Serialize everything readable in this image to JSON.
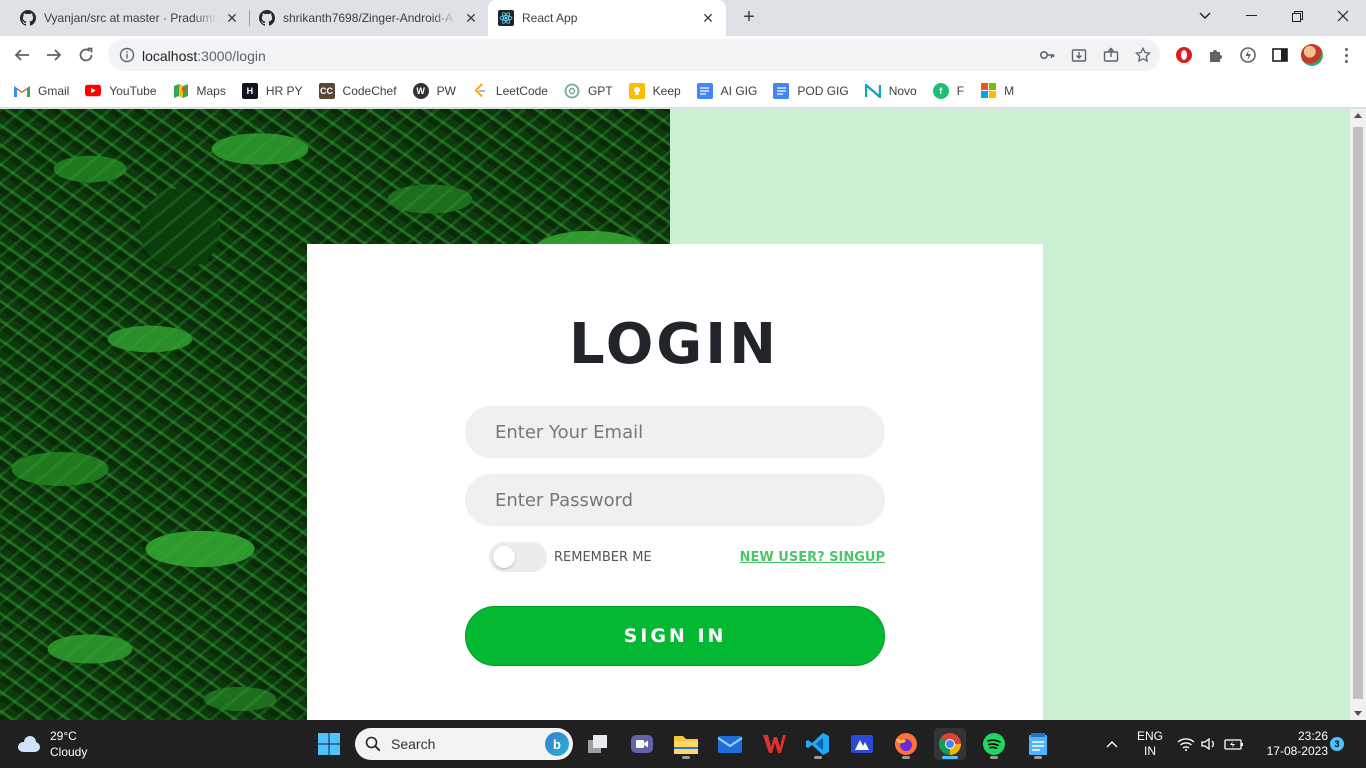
{
  "browser": {
    "tabs": [
      {
        "title": "Vyanjan/src at master · Pradumn",
        "favicon": "github-icon"
      },
      {
        "title": "shrikanth7698/Zinger-Android-A",
        "favicon": "github-icon"
      },
      {
        "title": "React App",
        "favicon": "react-icon"
      }
    ],
    "address": {
      "host": "localhost",
      "path": ":3000/login"
    },
    "bookmarks": [
      {
        "label": "Gmail",
        "icon": "gmail-icon",
        "color": "#ea4335"
      },
      {
        "label": "YouTube",
        "icon": "youtube-icon",
        "color": "#ff0000"
      },
      {
        "label": "Maps",
        "icon": "maps-icon",
        "color": "#34a853"
      },
      {
        "label": "HR PY",
        "icon": "hackerrank-icon",
        "color": "#0e141e"
      },
      {
        "label": "CodeChef",
        "icon": "codechef-icon",
        "color": "#5b4638"
      },
      {
        "label": "PW",
        "icon": "pw-icon",
        "color": "#333333"
      },
      {
        "label": "LeetCode",
        "icon": "leetcode-icon",
        "color": "#ffa116"
      },
      {
        "label": "GPT",
        "icon": "openai-icon",
        "color": "#74aa9c"
      },
      {
        "label": "Keep",
        "icon": "keep-icon",
        "color": "#fbbc04"
      },
      {
        "label": "AI GIG",
        "icon": "docs-icon",
        "color": "#4285f4"
      },
      {
        "label": "POD GIG",
        "icon": "docs-icon",
        "color": "#4285f4"
      },
      {
        "label": "Novo",
        "icon": "novo-icon",
        "color": "#13a3c2"
      },
      {
        "label": "F",
        "icon": "fiverr-icon",
        "color": "#1dbf73"
      },
      {
        "label": "M",
        "icon": "microsoft-icon",
        "color": "#f25022"
      }
    ]
  },
  "login": {
    "title": "LOGIN",
    "email_placeholder": "Enter Your Email",
    "password_placeholder": "Enter Password",
    "remember_label": "REMEMBER ME",
    "remember_checked": false,
    "signup_link": "NEW USER? SINGUP",
    "signin_button": "SIGN IN",
    "accent_color": "#04b833",
    "background_color": "#caefd3"
  },
  "taskbar": {
    "weather": {
      "temp": "29°C",
      "condition": "Cloudy"
    },
    "search_label": "Search",
    "language": {
      "line1": "ENG",
      "line2": "IN"
    },
    "clock": {
      "time": "23:26",
      "date": "17-08-2023"
    },
    "notification_count": "3"
  }
}
